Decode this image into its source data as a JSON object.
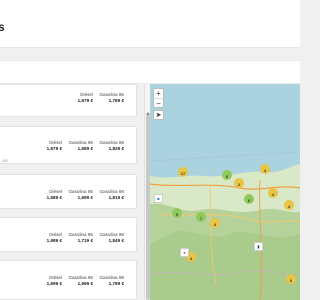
{
  "header": {
    "title": "s"
  },
  "stations": [
    {
      "cols": [
        {
          "label": "Diésel",
          "price": "1,679 €"
        },
        {
          "label": "Gasolina 95",
          "price": "1,769 €"
        }
      ],
      "sub": ""
    },
    {
      "cols": [
        {
          "label": "Diésel",
          "price": "1,679 €"
        },
        {
          "label": "Gasolina 95",
          "price": "1,689 €"
        },
        {
          "label": "Gasolina 98",
          "price": "1,829 €"
        }
      ],
      "sub": ":00"
    },
    {
      "cols": [
        {
          "label": "Diésel",
          "price": "1,689 €"
        },
        {
          "label": "Gasolina 95",
          "price": "1,699 €"
        },
        {
          "label": "Gasolina 98",
          "price": "1,819 €"
        }
      ],
      "sub": ""
    },
    {
      "cols": [
        {
          "label": "Diésel",
          "price": "1,689 €"
        },
        {
          "label": "Gasolina 95",
          "price": "1,719 €"
        },
        {
          "label": "Gasolina 98",
          "price": "1,849 €"
        }
      ],
      "sub": ""
    },
    {
      "cols": [
        {
          "label": "Diésel",
          "price": "1,699 €"
        },
        {
          "label": "Gasolina 95",
          "price": "1,699 €"
        },
        {
          "label": "Gasolina 98",
          "price": "1,799 €"
        }
      ],
      "sub": ""
    }
  ],
  "map": {
    "zoom_in": "+",
    "zoom_out": "−",
    "locate": "➤",
    "clusters": [
      {
        "label": "17",
        "color": "yellow"
      },
      {
        "label": "6",
        "color": "green"
      },
      {
        "label": "4",
        "color": "yellow"
      },
      {
        "label": "6",
        "color": "green"
      },
      {
        "label": "2",
        "color": "yellow"
      },
      {
        "label": "4",
        "color": "yellow"
      },
      {
        "label": "5",
        "color": "green"
      },
      {
        "label": "7",
        "color": "green"
      },
      {
        "label": "4",
        "color": "yellow"
      },
      {
        "label": "4",
        "color": "yellow"
      },
      {
        "label": "4",
        "color": "yellow"
      },
      {
        "label": "6",
        "color": "yellow"
      }
    ],
    "colors": {
      "sea": "#aad3df",
      "land": "#d9e8c6",
      "forest": "#b5d29a"
    }
  }
}
